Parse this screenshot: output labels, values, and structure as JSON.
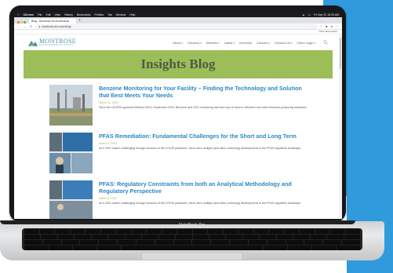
{
  "menubar": {
    "app": "Chrome",
    "items": [
      "File",
      "Edit",
      "View",
      "History",
      "Bookmarks",
      "Profiles",
      "Tab",
      "Window",
      "Help"
    ],
    "clock": "Fri Sep 22  10:25 AM"
  },
  "browser": {
    "tab_title": "Blog - Montrose Environmental",
    "url": "montrose-env.com/blog/",
    "bookmarks_label": "Other Bookmarks"
  },
  "site": {
    "logo_name": "MONTROSE",
    "logo_tagline": "ENVIRONMENTAL GROUP",
    "nav": [
      {
        "label": "About",
        "dropdown": true
      },
      {
        "label": "Services",
        "dropdown": true
      },
      {
        "label": "Markets",
        "dropdown": true
      },
      {
        "label": "Latest",
        "dropdown": true
      },
      {
        "label": "Investors",
        "dropdown": false
      },
      {
        "label": "Careers",
        "dropdown": true
      },
      {
        "label": "Contact Us",
        "dropdown": true
      },
      {
        "label": "Client Login",
        "dropdown": true
      }
    ],
    "banner_title": "Insights Blog"
  },
  "posts": [
    {
      "title": "Benzene Monitoring for Your Facility – Finding the Technology and Solution that Best Meets Your Needs",
      "date": "March 11, 2022",
      "excerpt": "Since the US EPA approved Method 325 in September 2015, Benzene and VOC monitoring has been top of mind in refineries and other benzene-producing industries."
    },
    {
      "title": "PFAS Remediation: Fundamental Challenges for the Short and Long Term",
      "date": "March 9, 2022",
      "excerpt": "As if 2021 wasn't challenging enough because of the COVID pandemic, there were multiple (and often confusing) developments in the PFAS regulation landscape."
    },
    {
      "title": "PFAS: Regulatory Constraints from both an Analytical Methodology and Regulatory Perspective",
      "date": "March 8, 2022",
      "excerpt": "As if 2021 wasn't challenging enough because of the COVID pandemic, there were multiple (and often confusing) developments in the PFAS regulation landscape."
    }
  ],
  "laptop": {
    "brand": "NoteBook Pro"
  },
  "colors": {
    "accent_green": "#9cbe58",
    "link_blue": "#2c87c5",
    "backdrop_blue": "#2f9bdc"
  }
}
